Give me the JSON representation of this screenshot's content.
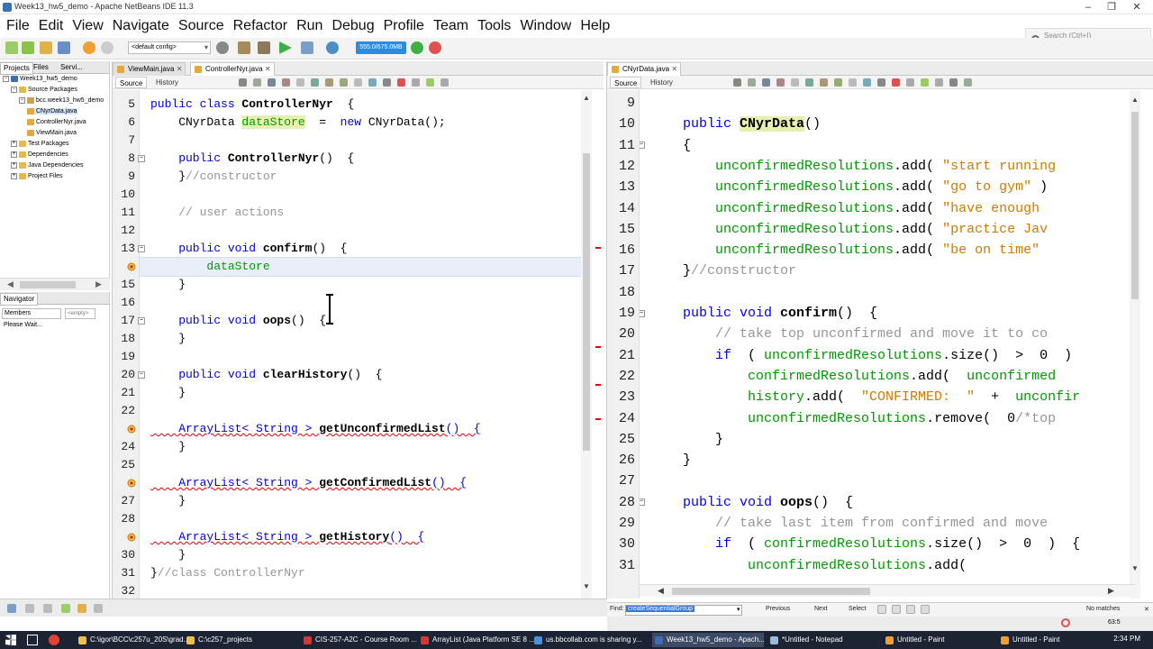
{
  "window": {
    "title": "Week13_hw5_demo - Apache NetBeans IDE 11.3",
    "minimize": "–",
    "restore": "❐",
    "close": "✕"
  },
  "menu": [
    "File",
    "Edit",
    "View",
    "Navigate",
    "Source",
    "Refactor",
    "Run",
    "Debug",
    "Profile",
    "Team",
    "Tools",
    "Window",
    "Help"
  ],
  "search": {
    "placeholder": "Search (Ctrl+I)"
  },
  "toolbar": {
    "config": "<default config>",
    "perf": "555.0/675.0MB"
  },
  "project_panel": {
    "tabs": [
      "Projects",
      "Files",
      "Servi..."
    ],
    "tree": [
      {
        "label": "Week13_hw5_demo",
        "indent": 0,
        "toggle": "−",
        "icon": "project"
      },
      {
        "label": "Source Packages",
        "indent": 1,
        "toggle": "−",
        "icon": "folder"
      },
      {
        "label": "bcc.week13_hw5_demo",
        "indent": 2,
        "toggle": "−",
        "icon": "package"
      },
      {
        "label": "CNyrData.java",
        "indent": 3,
        "toggle": "",
        "icon": "java",
        "selected": true
      },
      {
        "label": "ControllerNyr.java",
        "indent": 3,
        "toggle": "",
        "icon": "java"
      },
      {
        "label": "ViewMain.java",
        "indent": 3,
        "toggle": "",
        "icon": "java"
      },
      {
        "label": "Test Packages",
        "indent": 1,
        "toggle": "+",
        "icon": "folder"
      },
      {
        "label": "Dependencies",
        "indent": 1,
        "toggle": "+",
        "icon": "folder"
      },
      {
        "label": "Java Dependencies",
        "indent": 1,
        "toggle": "+",
        "icon": "folder"
      },
      {
        "label": "Project Files",
        "indent": 1,
        "toggle": "+",
        "icon": "folder"
      }
    ]
  },
  "navigator": {
    "title": "Navigator",
    "members": "Members",
    "empty_select": "<empty>",
    "status": "Please Wait..."
  },
  "left_editor": {
    "tabs": [
      {
        "label": "ViewMain.java",
        "active": false
      },
      {
        "label": "ControllerNyr.java",
        "active": true
      }
    ],
    "source_tab": "Source",
    "history_tab": "History",
    "lines": [
      {
        "n": "5",
        "code": [
          [
            "kw",
            "public class "
          ],
          [
            "fn",
            "ControllerNyr"
          ],
          [
            "",
            "  {"
          ]
        ]
      },
      {
        "n": "6",
        "code": [
          [
            "",
            "    CNyrData "
          ],
          [
            "fieldhl",
            "dataStore"
          ],
          [
            "",
            "  =  "
          ],
          [
            "kw",
            "new"
          ],
          [
            "",
            " CNyrData();"
          ]
        ]
      },
      {
        "n": "7",
        "code": []
      },
      {
        "n": "8",
        "code": [
          [
            "kw",
            "    public "
          ],
          [
            "fn",
            "ControllerNyr"
          ],
          [
            "",
            "()  {"
          ]
        ],
        "fold": "−"
      },
      {
        "n": "9",
        "code": [
          [
            "",
            "    }"
          ],
          [
            "cmt",
            "//constructor"
          ]
        ]
      },
      {
        "n": "10",
        "code": []
      },
      {
        "n": "11",
        "code": [
          [
            "cmt",
            "    // user actions"
          ]
        ]
      },
      {
        "n": "12",
        "code": []
      },
      {
        "n": "13",
        "code": [
          [
            "kw",
            "    public void "
          ],
          [
            "fn",
            "confirm"
          ],
          [
            "",
            "()  {"
          ]
        ],
        "fold": "−"
      },
      {
        "n": "",
        "code": [
          [
            "fld",
            "        dataStore"
          ]
        ],
        "current": true,
        "badge": true
      },
      {
        "n": "15",
        "code": [
          [
            "",
            "    }"
          ]
        ]
      },
      {
        "n": "16",
        "code": []
      },
      {
        "n": "17",
        "code": [
          [
            "kw",
            "    public void "
          ],
          [
            "fn",
            "oops"
          ],
          [
            "",
            "()  {"
          ]
        ],
        "fold": "−"
      },
      {
        "n": "18",
        "code": [
          [
            "",
            "    }"
          ]
        ]
      },
      {
        "n": "19",
        "code": []
      },
      {
        "n": "20",
        "code": [
          [
            "kw",
            "    public void "
          ],
          [
            "fn",
            "clearHistory"
          ],
          [
            "",
            "()  {"
          ]
        ],
        "fold": "−"
      },
      {
        "n": "21",
        "code": [
          [
            "",
            "    }"
          ]
        ]
      },
      {
        "n": "22",
        "code": []
      },
      {
        "n": "",
        "code": [
          [
            "err",
            "    ArrayList< String > "
          ],
          [
            "errfn",
            "getUnconfirmedList"
          ],
          [
            "err",
            "()  {"
          ]
        ],
        "badge": true
      },
      {
        "n": "24",
        "code": [
          [
            "",
            "    }"
          ]
        ]
      },
      {
        "n": "25",
        "code": []
      },
      {
        "n": "",
        "code": [
          [
            "err",
            "    ArrayList< String > "
          ],
          [
            "errfn",
            "getConfirmedList"
          ],
          [
            "err",
            "()  {"
          ]
        ],
        "badge": true
      },
      {
        "n": "27",
        "code": [
          [
            "",
            "    }"
          ]
        ]
      },
      {
        "n": "28",
        "code": []
      },
      {
        "n": "",
        "code": [
          [
            "err",
            "    ArrayList< String > "
          ],
          [
            "errfn",
            "getHistory"
          ],
          [
            "err",
            "()  {"
          ]
        ],
        "badge": true
      },
      {
        "n": "30",
        "code": [
          [
            "",
            "    }"
          ]
        ]
      },
      {
        "n": "31",
        "code": [
          [
            "",
            "}"
          ],
          [
            "cmt",
            "//class ControllerNyr"
          ]
        ]
      },
      {
        "n": "32",
        "code": []
      }
    ]
  },
  "right_editor": {
    "tabs": [
      {
        "label": "CNyrData.java",
        "active": true
      }
    ],
    "source_tab": "Source",
    "history_tab": "History",
    "lines": [
      {
        "n": "9",
        "code": []
      },
      {
        "n": "10",
        "code": [
          [
            "kw",
            "    public "
          ],
          [
            "fnhl",
            "CNyrData"
          ],
          [
            "",
            "()"
          ]
        ]
      },
      {
        "n": "11",
        "code": [
          [
            "",
            "    {"
          ]
        ],
        "fold": "−"
      },
      {
        "n": "12",
        "code": [
          [
            "fld",
            "        unconfirmedResolutions"
          ],
          [
            "",
            ".add( "
          ],
          [
            "str",
            "\"start running"
          ]
        ]
      },
      {
        "n": "13",
        "code": [
          [
            "fld",
            "        unconfirmedResolutions"
          ],
          [
            "",
            ".add( "
          ],
          [
            "str",
            "\"go to gym\""
          ],
          [
            "",
            " )"
          ]
        ]
      },
      {
        "n": "14",
        "code": [
          [
            "fld",
            "        unconfirmedResolutions"
          ],
          [
            "",
            ".add( "
          ],
          [
            "str",
            "\"have enough "
          ]
        ]
      },
      {
        "n": "15",
        "code": [
          [
            "fld",
            "        unconfirmedResolutions"
          ],
          [
            "",
            ".add( "
          ],
          [
            "str",
            "\"practice Jav"
          ]
        ]
      },
      {
        "n": "16",
        "code": [
          [
            "fld",
            "        unconfirmedResolutions"
          ],
          [
            "",
            ".add( "
          ],
          [
            "str",
            "\"be on time\""
          ]
        ]
      },
      {
        "n": "17",
        "code": [
          [
            "",
            "    }"
          ],
          [
            "cmt",
            "//constructor"
          ]
        ]
      },
      {
        "n": "18",
        "code": []
      },
      {
        "n": "19",
        "code": [
          [
            "kw",
            "    public void "
          ],
          [
            "fn",
            "confirm"
          ],
          [
            "",
            "()  {"
          ]
        ],
        "fold": "−"
      },
      {
        "n": "20",
        "code": [
          [
            "cmt",
            "        // take top unconfirmed and move it to co"
          ]
        ]
      },
      {
        "n": "21",
        "code": [
          [
            "kw",
            "        if"
          ],
          [
            "",
            "  ( "
          ],
          [
            "fld",
            "unconfirmedResolutions"
          ],
          [
            "",
            ".size()  >  0  )"
          ]
        ]
      },
      {
        "n": "22",
        "code": [
          [
            "fld",
            "            confirmedResolutions"
          ],
          [
            "",
            ".add(  "
          ],
          [
            "fld",
            "unconfirmed"
          ]
        ]
      },
      {
        "n": "23",
        "code": [
          [
            "fld",
            "            history"
          ],
          [
            "",
            ".add(  "
          ],
          [
            "str",
            "\"CONFIRMED:  \""
          ],
          [
            "",
            "  +  "
          ],
          [
            "fld",
            "unconfir"
          ]
        ]
      },
      {
        "n": "24",
        "code": [
          [
            "fld",
            "            unconfirmedResolutions"
          ],
          [
            "",
            ".remove(  0"
          ],
          [
            "cmt",
            "/*top"
          ]
        ]
      },
      {
        "n": "25",
        "code": [
          [
            "",
            "        }"
          ]
        ]
      },
      {
        "n": "26",
        "code": [
          [
            "",
            "    }"
          ]
        ]
      },
      {
        "n": "27",
        "code": []
      },
      {
        "n": "28",
        "code": [
          [
            "kw",
            "    public void "
          ],
          [
            "fn",
            "oops"
          ],
          [
            "",
            "()  {"
          ]
        ],
        "fold": "−"
      },
      {
        "n": "29",
        "code": [
          [
            "cmt",
            "        // take last item from confirmed and move"
          ]
        ]
      },
      {
        "n": "30",
        "code": [
          [
            "kw",
            "        if"
          ],
          [
            "",
            "  ( "
          ],
          [
            "fld",
            "confirmedResolutions"
          ],
          [
            "",
            ".size()  >  0  )  {"
          ]
        ]
      },
      {
        "n": "31",
        "code": [
          [
            "fld",
            "            unconfirmedResolutions"
          ],
          [
            "",
            ".add("
          ]
        ]
      }
    ]
  },
  "findbar": {
    "label": "Find:",
    "value": "createSequentialGroup",
    "previous": "Previous",
    "next": "Next",
    "select": "Select",
    "status": "No matches"
  },
  "status": {
    "position": "63:5"
  },
  "taskbar": {
    "items": [
      {
        "label": "C:\\igor\\BCC\\c257u_20S\\grad...",
        "color": "#f0c040"
      },
      {
        "label": "C:\\c257_projects",
        "color": "#f0c040"
      },
      {
        "label": "CIS-257-A2C - Course Room ...",
        "color": "#d33"
      },
      {
        "label": "ArrayList (Java Platform SE 8 ...",
        "color": "#d33"
      },
      {
        "label": "us.bbcollab.com is sharing y...",
        "color": "#4a90e2"
      },
      {
        "label": "Week13_hw5_demo - Apach...",
        "color": "#3b6fb6",
        "active": true
      },
      {
        "label": "*Untitled - Notepad",
        "color": "#9bd"
      },
      {
        "label": "Untitled - Paint",
        "color": "#f0a030"
      },
      {
        "label": "Untitled - Paint",
        "color": "#f0a030"
      }
    ],
    "clock": "2:34 PM"
  },
  "colors": {
    "keyword": "#0000e6",
    "comment": "#969696",
    "string": "#ce7b00",
    "field": "#009900",
    "error": "#e00000",
    "taskbar": "#1c2333"
  }
}
